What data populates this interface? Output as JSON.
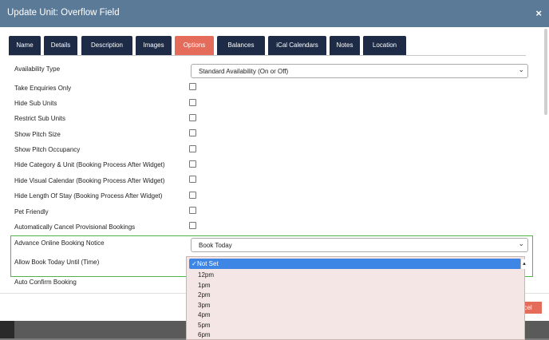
{
  "header": {
    "title": "Update Unit: Overflow Field",
    "close": "×"
  },
  "tabs": [
    {
      "label": "Name"
    },
    {
      "label": "Details"
    },
    {
      "label": "Description"
    },
    {
      "label": "Images"
    },
    {
      "label": "Options",
      "active": true
    },
    {
      "label": "Balances"
    },
    {
      "label": "iCal Calendars"
    },
    {
      "label": "Notes"
    },
    {
      "label": "Location"
    }
  ],
  "form": {
    "availability_type": {
      "label": "Availability Type",
      "value": "Standard Availability (On or Off)"
    },
    "checkbox_rows": [
      {
        "label": "Take Enquiries Only",
        "checked": false
      },
      {
        "label": "Hide Sub Units",
        "checked": false
      },
      {
        "label": "Restrict Sub Units",
        "checked": false
      },
      {
        "label": "Show Pitch Size",
        "checked": false
      },
      {
        "label": "Show Pitch Occupancy",
        "checked": false
      },
      {
        "label": "Hide Category & Unit (Booking Process After Widget)",
        "checked": false
      },
      {
        "label": "Hide Visual Calendar (Booking Process After Widget)",
        "checked": false
      },
      {
        "label": "Hide Length Of Stay (Booking Process After Widget)",
        "checked": false
      },
      {
        "label": "Pet Friendly",
        "checked": false
      },
      {
        "label": "Automatically Cancel Provisional Bookings",
        "checked": false
      }
    ],
    "advance_notice": {
      "label": "Advance Online Booking Notice",
      "value": "Book Today"
    },
    "book_today_until": {
      "label": "Allow Book Today Until (Time)",
      "options": [
        "Not Set",
        "12pm",
        "1pm",
        "2pm",
        "3pm",
        "4pm",
        "5pm",
        "6pm"
      ],
      "selected": "Not Set"
    },
    "auto_confirm": {
      "label": "Auto Confirm Booking"
    }
  },
  "footer": {
    "cancel_label": "Cancel",
    "cancel_visible": "ncel"
  },
  "colors": {
    "header_bg": "#5b7a98",
    "tab_bg": "#1d2b46",
    "tab_active": "#e56b5b",
    "highlight_border": "#52b348",
    "dropdown_selected": "#3d86e6"
  }
}
